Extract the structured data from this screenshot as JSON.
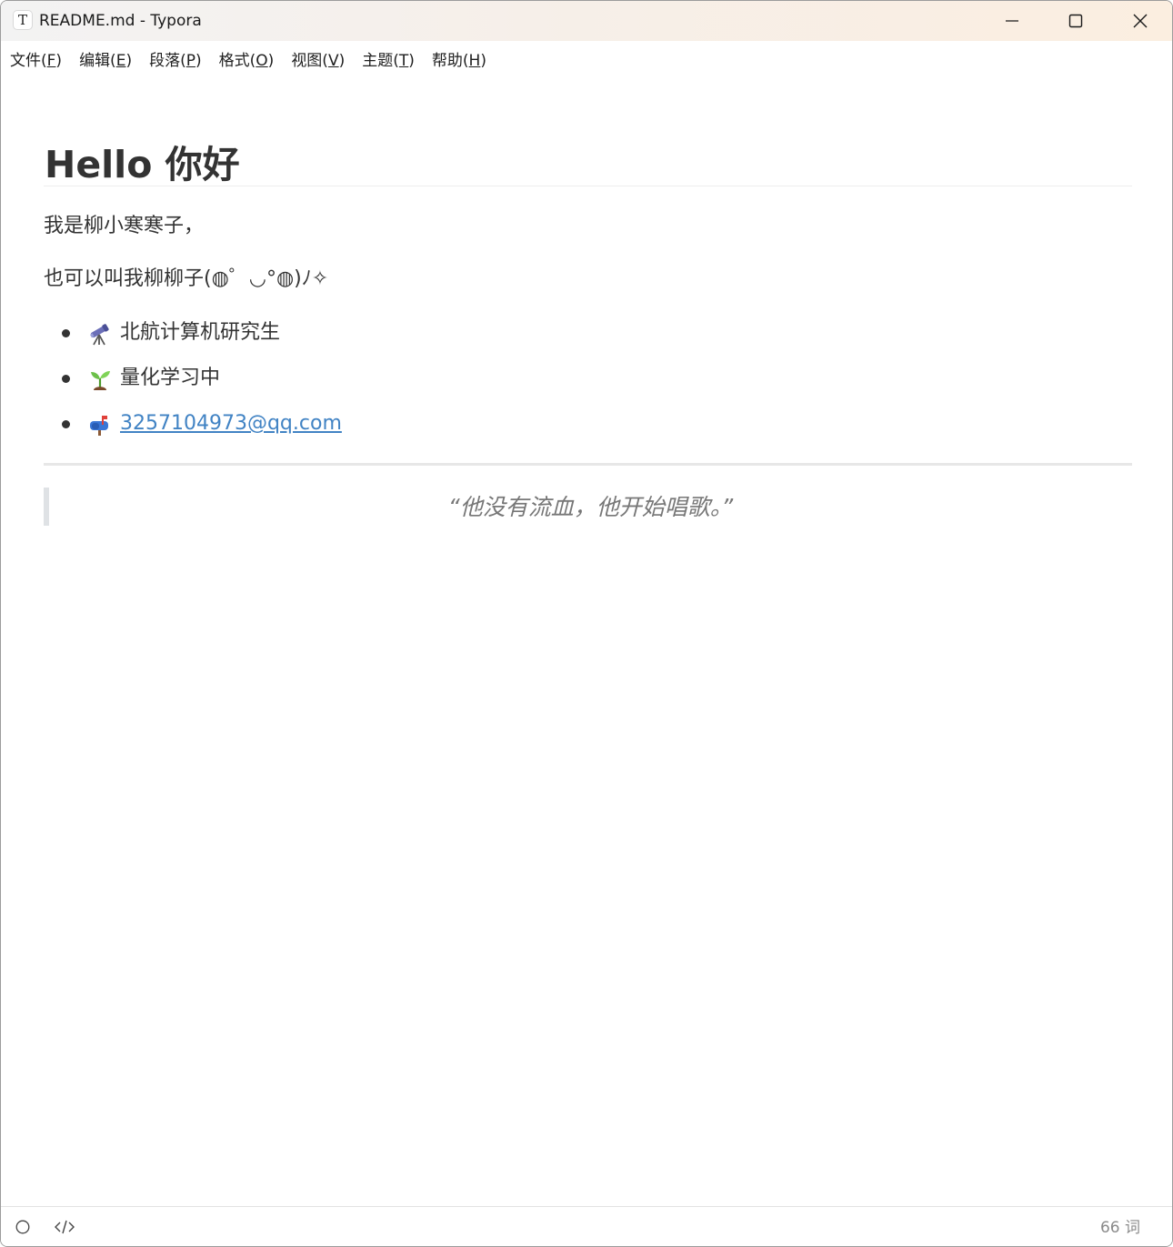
{
  "window": {
    "title": "README.md - Typora",
    "app_icon_letter": "T"
  },
  "menu": [
    {
      "label": "文件(",
      "key": "F",
      "close": ")"
    },
    {
      "label": "编辑(",
      "key": "E",
      "close": ")"
    },
    {
      "label": "段落(",
      "key": "P",
      "close": ")"
    },
    {
      "label": "格式(",
      "key": "O",
      "close": ")"
    },
    {
      "label": "视图(",
      "key": "V",
      "close": ")"
    },
    {
      "label": "主题(",
      "key": "T",
      "close": ")"
    },
    {
      "label": "帮助(",
      "key": "H",
      "close": ")"
    }
  ],
  "document": {
    "heading": "Hello 你好",
    "paragraph1": "我是柳小寒寒子，",
    "paragraph2": "也可以叫我柳柳子(◍゜◡°◍)ﾉ✧",
    "list": [
      {
        "icon": "telescope-icon",
        "text": "北航计算机研究生"
      },
      {
        "icon": "seedling-icon",
        "text": "量化学习中"
      },
      {
        "icon": "mailbox-icon",
        "text": "3257104973@qq.com",
        "is_link": true
      }
    ],
    "quote": "“他没有流血，他开始唱歌。”"
  },
  "statusbar": {
    "word_count": "66 词",
    "left_icons": [
      "outline-toggle-icon",
      "source-code-icon"
    ]
  },
  "colors": {
    "link": "#4183c4",
    "text": "#333333",
    "quote_text": "#777777",
    "quote_bar": "#dfe2e5"
  }
}
